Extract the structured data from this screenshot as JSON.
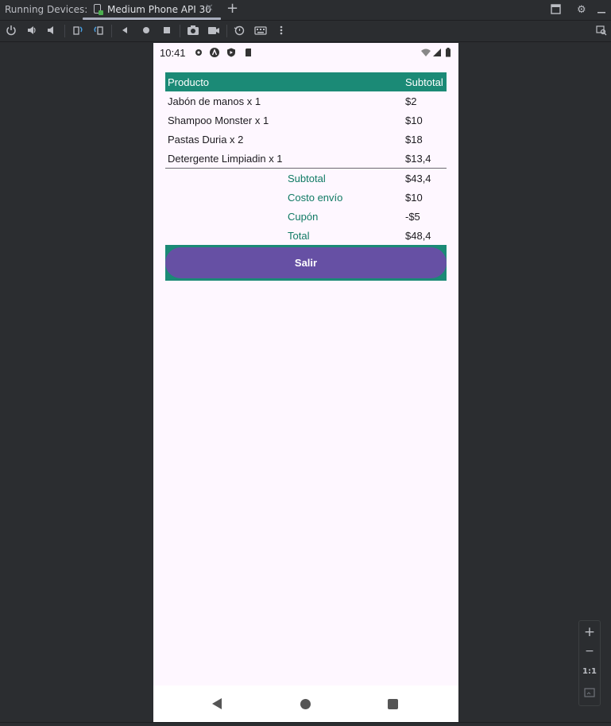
{
  "tabbar": {
    "title": "Running Devices:",
    "tab_label": "Medium Phone API 30",
    "close": "✕",
    "add": "+"
  },
  "device": {
    "status_time": "10:41",
    "table": {
      "header": {
        "product": "Producto",
        "subtotal": "Subtotal"
      },
      "rows": [
        {
          "product": "Jabón de manos x 1",
          "subtotal": "$2"
        },
        {
          "product": "Shampoo Monster x 1",
          "subtotal": "$10"
        },
        {
          "product": "Pastas Duria x 2",
          "subtotal": "$18"
        },
        {
          "product": "Detergente Limpiadin x 1",
          "subtotal": "$13,4"
        }
      ]
    },
    "summary": [
      {
        "label": "Subtotal",
        "value": "$43,4"
      },
      {
        "label": "Costo envío",
        "value": "$10"
      },
      {
        "label": "Cupón",
        "value": "-$5"
      },
      {
        "label": "Total",
        "value": "$48,4"
      }
    ],
    "exit_button": "Salir"
  },
  "zoom": {
    "plus": "+",
    "minus": "−",
    "one_to_one": "1:1"
  },
  "colors": {
    "header_bg": "#1b8a76",
    "button_bg": "#6650a4",
    "summary_label": "#107a64"
  }
}
